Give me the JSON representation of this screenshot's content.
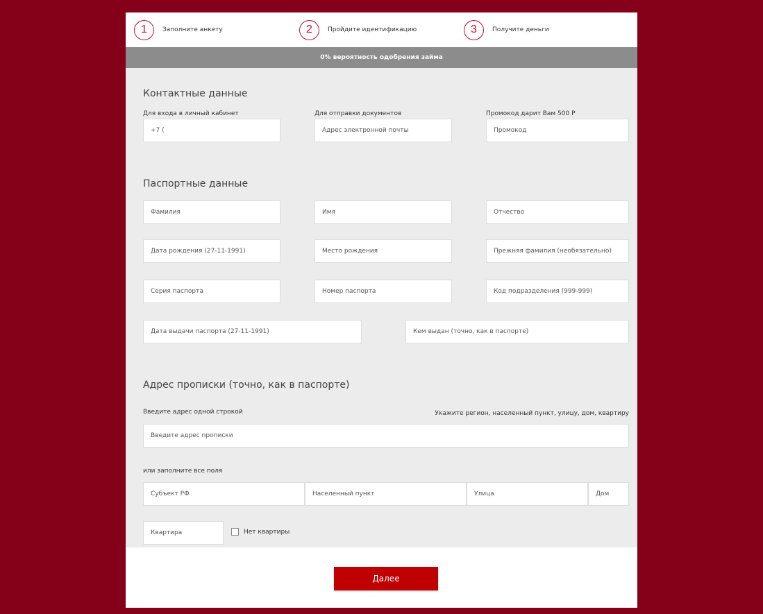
{
  "steps": [
    {
      "num": "1",
      "label": "Заполните анкету"
    },
    {
      "num": "2",
      "label": "Пройдите идентификацию"
    },
    {
      "num": "3",
      "label": "Получите деньги"
    }
  ],
  "approval": {
    "text": "0% вероятность одобрения займа"
  },
  "contacts": {
    "title": "Контактные данные",
    "phone_label": "Для входа в личный кабинет",
    "phone_value": "+7 (",
    "email_label": "Для отправки документов",
    "email_placeholder": "Адрес электронной почты",
    "promo_label": "Промокод дарит Вам 500 Р",
    "promo_placeholder": "Промокод"
  },
  "passport": {
    "title": "Паспортные данные",
    "surname": "Фамилия",
    "name": "Имя",
    "patronymic": "Отчество",
    "birth_date": "Дата рождения (27-11-1991)",
    "birth_place": "Место рождения",
    "prev_surname": "Прежняя фамилия (необязательно)",
    "series": "Серия паспорта",
    "number": "Номер паспорта",
    "division_code": "Код подразделения (999-999)",
    "issue_date": "Дата выдачи паспорта (27-11-1991)",
    "issued_by": "Кем выдан (точно, как в паспорте)"
  },
  "address": {
    "title": "Адрес прописки (точно, как в паспорте)",
    "one_line_label": "Введите адрес одной строкой",
    "hint": "Укажите регион, населенный пункт, улицу, дом, квартиру",
    "full_placeholder": "Введите адрес прописки",
    "or_label": "или заполните все поля",
    "region": "Субъект РФ",
    "locality": "Населенный пункт",
    "street": "Улица",
    "house": "Дом",
    "apartment": "Квартира",
    "no_apartment": "Нет квартиры"
  },
  "actions": {
    "next_label": "Далее"
  },
  "colors": {
    "background": "#850019",
    "accent": "#c8102e",
    "button": "#c00000",
    "bar": "#8c8c8c"
  }
}
